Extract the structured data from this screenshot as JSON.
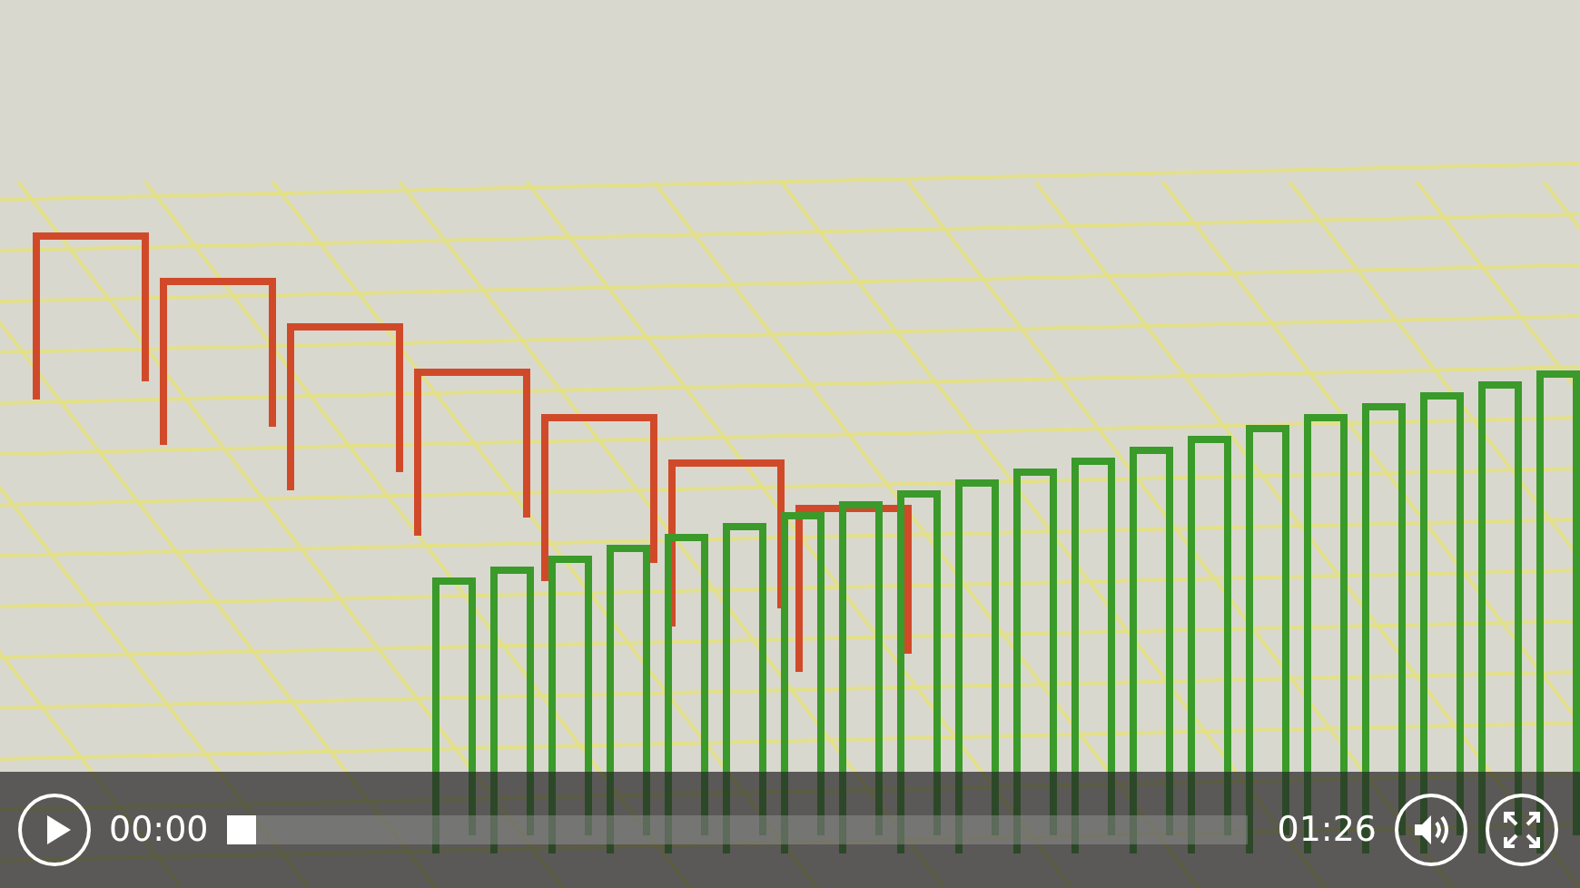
{
  "player": {
    "playing": false,
    "elapsed": "00:00",
    "level": 0,
    "duration": "01:26",
    "muted": false
  }
}
